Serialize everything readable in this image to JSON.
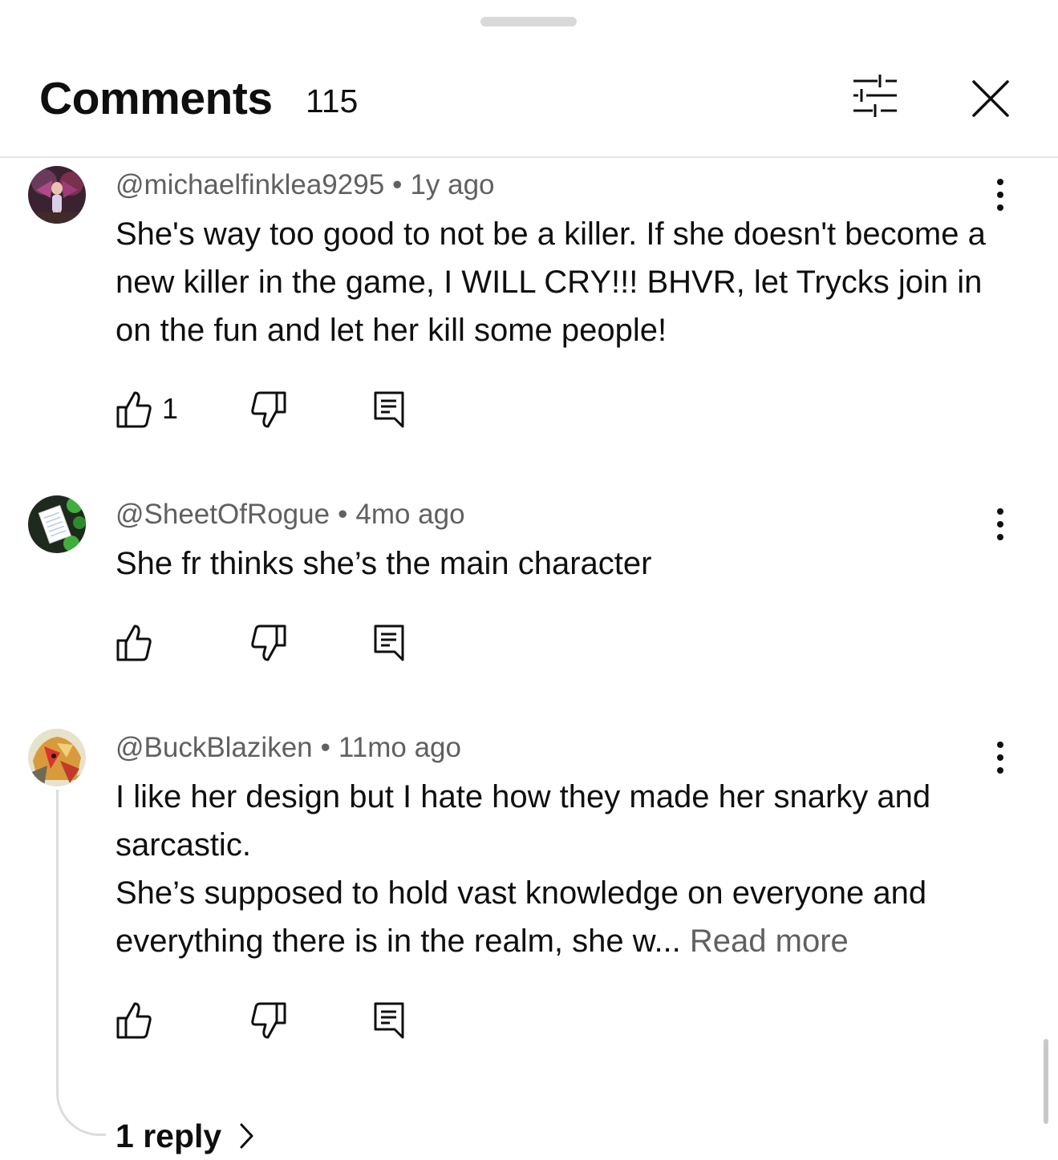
{
  "header": {
    "title": "Comments",
    "count": "115",
    "filter_icon": "sliders-icon",
    "close_icon": "close-icon"
  },
  "comments": [
    {
      "author": "@michaelfinklea9295",
      "time": "1y ago",
      "text_lines": [
        "She's way too good to not be a killer. If she doesn't become a new killer in the game, I WILL CRY!!! BHVR, let Trycks join in on the fun and let her kill some people!"
      ],
      "likes": "1"
    },
    {
      "author": "@SheetOfRogue",
      "time": "4mo ago",
      "text_lines": [
        "She fr thinks she’s the main character"
      ],
      "likes": ""
    },
    {
      "author": "@BuckBlaziken",
      "time": "11mo ago",
      "text_lines": [
        "I like her design but I hate how they made her snarky and sarcastic.",
        "She’s supposed to hold vast knowledge on everyone and everything there is in the realm, she w..."
      ],
      "read_more": "Read more",
      "likes": "",
      "replies": "1 reply"
    }
  ],
  "separator": "•",
  "colors": {
    "text_primary": "#0f0f0f",
    "text_secondary": "#606060",
    "divider": "#e5e5e5"
  }
}
